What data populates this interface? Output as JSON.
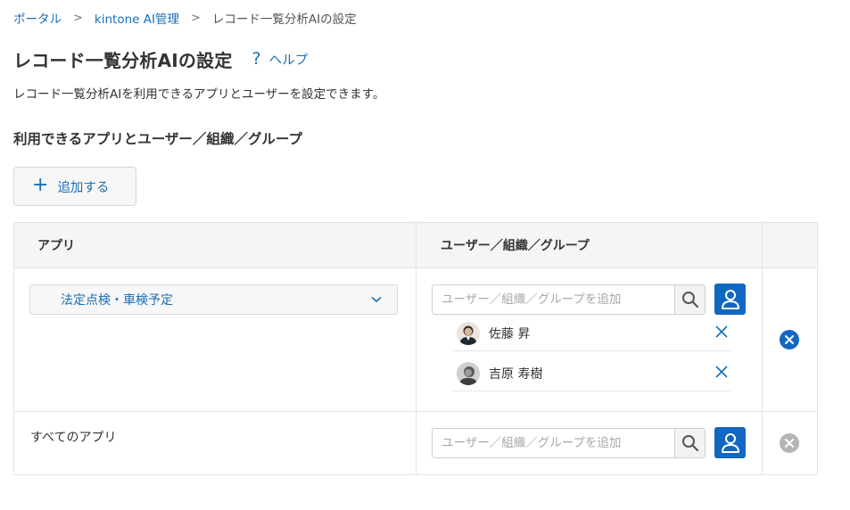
{
  "breadcrumb": {
    "items": [
      "ポータル",
      "kintone AI管理"
    ],
    "current": "レコード一覧分析AIの設定",
    "separator": ">"
  },
  "page": {
    "title": "レコード一覧分析AIの設定",
    "help_label": "ヘルプ",
    "description": "レコード一覧分析AIを利用できるアプリとユーザーを設定できます。"
  },
  "section": {
    "title": "利用できるアプリとユーザー／組織／グループ",
    "add_label": "追加する"
  },
  "table": {
    "headers": {
      "app": "アプリ",
      "users": "ユーザー／組織／グループ"
    },
    "search_placeholder": "ユーザー／組織／グループを追加",
    "rows": [
      {
        "app": "法定点検・車検予定",
        "app_editable": true,
        "entities": [
          {
            "name": "佐藤 昇",
            "avatar": "avatar-sato"
          },
          {
            "name": "吉原 寿樹",
            "avatar": "avatar-yoshihara"
          }
        ],
        "deletable": true
      },
      {
        "app": "すべてのアプリ",
        "app_editable": false,
        "entities": [],
        "deletable": false
      }
    ]
  },
  "colors": {
    "link": "#1a6fb5",
    "primary_button": "#1167c1",
    "delete_active": "#1167c1",
    "delete_disabled": "#b5b5b5"
  }
}
